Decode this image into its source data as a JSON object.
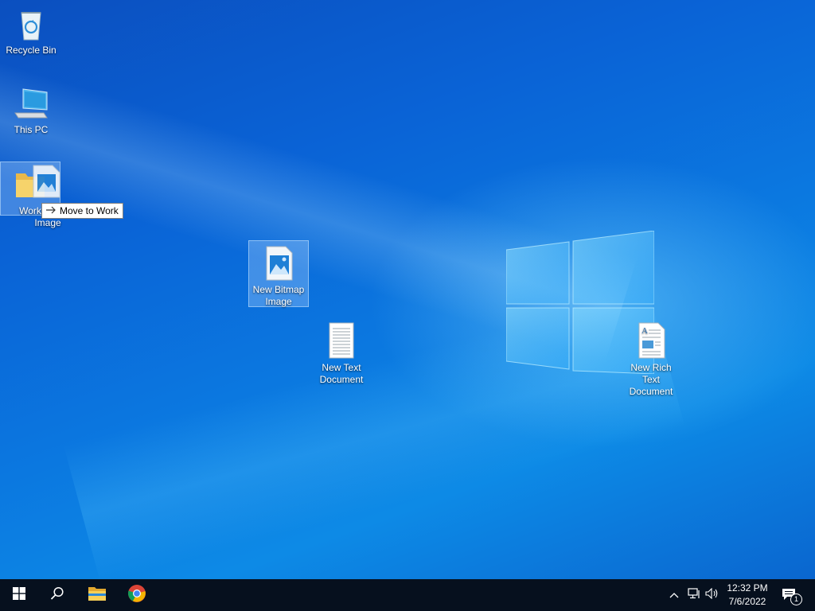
{
  "desktop": {
    "icons": [
      {
        "label": "Recycle Bin"
      },
      {
        "label": "This PC"
      },
      {
        "label": "Work",
        "drag_ghost_label": "Image"
      },
      {
        "label": "New Bitmap Image"
      },
      {
        "label": "New Text Document"
      },
      {
        "label": "New Rich Text Document"
      }
    ],
    "drag_tooltip": {
      "icon": "arrow-right-icon",
      "text": "Move to Work"
    }
  },
  "taskbar": {
    "start": {
      "icon": "windows-start-icon"
    },
    "search": {
      "icon": "search-icon"
    },
    "pinned": [
      {
        "name": "File Explorer",
        "icon": "folder-icon"
      },
      {
        "name": "Google Chrome",
        "icon": "chrome-icon"
      }
    ],
    "tray": {
      "overflow_icon": "chevron-up-icon",
      "network_icon": "network-icon",
      "volume_icon": "volume-icon",
      "time": "12:32 PM",
      "date": "7/6/2022",
      "notification_count": "1"
    }
  },
  "colors": {
    "desktop_blue": "#0b6fdc",
    "taskbar": "#06101e",
    "selection": "#aad2ff"
  }
}
